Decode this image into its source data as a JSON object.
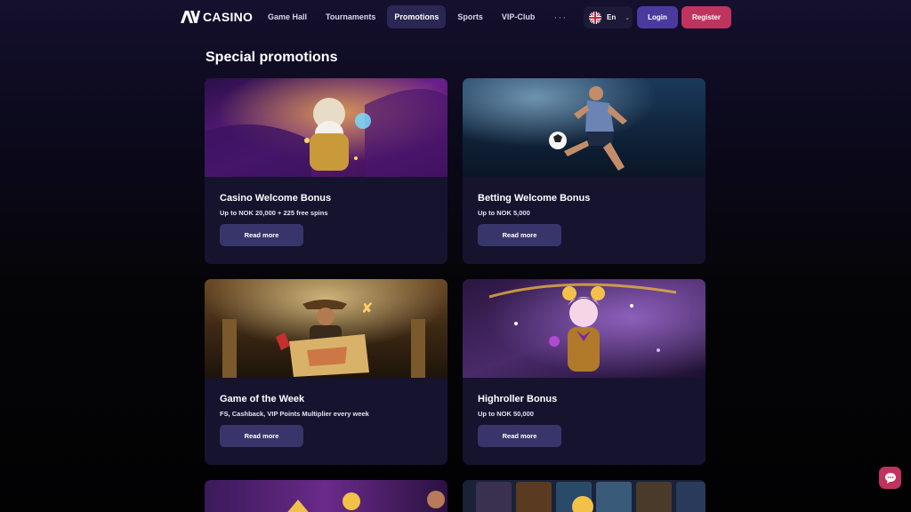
{
  "header": {
    "logo_text": "CASINO",
    "nav": [
      {
        "label": "Game Hall",
        "active": false
      },
      {
        "label": "Tournaments",
        "active": false
      },
      {
        "label": "Promotions",
        "active": true
      },
      {
        "label": "Sports",
        "active": false
      },
      {
        "label": "VIP-Club",
        "active": false
      }
    ],
    "more_label": "···",
    "language": "En",
    "login_label": "Login",
    "register_label": "Register"
  },
  "page_title": "Special promotions",
  "promotions": [
    {
      "title": "Casino Welcome Bonus",
      "subtitle": "Up to NOK 20,000 + 225 free spins",
      "button": "Read more",
      "image": "zeus-god-art"
    },
    {
      "title": "Betting Welcome Bonus",
      "subtitle": "Up to NOK 5,000",
      "button": "Read more",
      "image": "football-player-art"
    },
    {
      "title": "Game of the Week",
      "subtitle": "FS, Cashback, VIP Points Multiplier every week",
      "button": "Read more",
      "image": "explorer-treasure-map-art"
    },
    {
      "title": "Highroller Bonus",
      "subtitle": "Up to NOK 50,000",
      "button": "Read more",
      "image": "clown-girl-art"
    }
  ],
  "colors": {
    "accent_purple": "#4a3a9e",
    "register_pink": "#c0335e",
    "card_bg": "#16132f",
    "button_bg": "#38356a"
  }
}
